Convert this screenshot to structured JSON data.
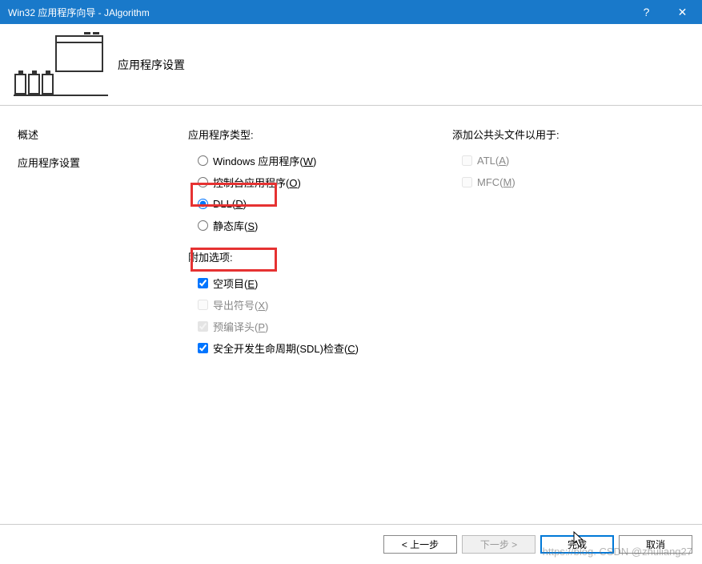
{
  "titlebar": {
    "text": "Win32 应用程序向导 - JAlgorithm",
    "help": "?",
    "close": "✕"
  },
  "banner": {
    "title": "应用程序设置"
  },
  "sidebar": {
    "overview": "概述",
    "app_settings": "应用程序设置"
  },
  "main": {
    "app_type_label": "应用程序类型:",
    "app_type_options": {
      "windows": "Windows 应用程序(W)",
      "console": "控制台应用程序(O)",
      "dll": "DLL(D)",
      "static": "静态库(S)"
    },
    "extra_label": "附加选项:",
    "extra_options": {
      "empty": "空项目(E)",
      "export": "导出符号(X)",
      "precompiled": "预编译头(P)",
      "sdl": "安全开发生命周期(SDL)检查(C)"
    },
    "public_header_label": "添加公共头文件以用于:",
    "public_header_options": {
      "atl": "ATL(A)",
      "mfc": "MFC(M)"
    }
  },
  "footer": {
    "prev": "< 上一步",
    "next": "下一步 >",
    "finish": "完成",
    "cancel": "取消"
  },
  "watermark": "https://blog. CSDN @zhuliang27"
}
